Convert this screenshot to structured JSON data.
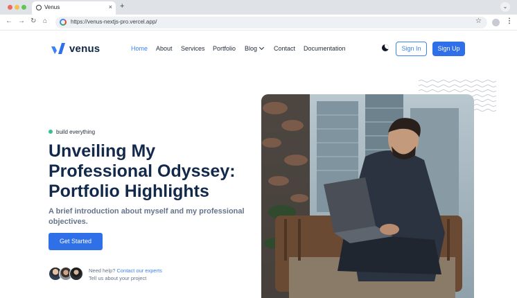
{
  "browser": {
    "tab_title": "Venus",
    "tab_close": "×",
    "new_tab": "+",
    "tabbar_chevron": "⌄",
    "back": "←",
    "forward": "→",
    "reload": "↻",
    "home": "⌂",
    "url": "https://venus-nextjs-pro.vercel.app/",
    "bookmark": "☆",
    "menu": "⋮"
  },
  "header": {
    "logo_text": "venus",
    "nav": [
      {
        "label": "Home",
        "active": true
      },
      {
        "label": "About"
      },
      {
        "label": "Services"
      },
      {
        "label": "Portfolio"
      },
      {
        "label": "Blog"
      },
      {
        "label": "Contact"
      },
      {
        "label": "Documentation"
      }
    ],
    "signin": "Sign In",
    "signup": "Sign Up"
  },
  "hero": {
    "badge": "build everything",
    "title": "Unveiling My Professional Odyssey: Portfolio Highlights",
    "subtitle": "A brief introduction about myself and my professional objectives.",
    "cta": "Get Started",
    "help_prefix": "Need help?",
    "help_link": "Contact our experts",
    "help_line2": "Tell us about your project"
  },
  "colors": {
    "primary": "#2f6fe8",
    "accent_blue": "#3b82f6",
    "heading": "#13294b",
    "muted": "#64748b",
    "badge_dot": "#34c38f"
  },
  "icons": [
    "tab-favicon-icon",
    "close-icon",
    "plus-icon",
    "back-arrow-icon",
    "forward-arrow-icon",
    "reload-icon",
    "home-icon",
    "google-icon",
    "star-icon",
    "profile-icon",
    "kebab-menu-icon",
    "chevron-down-icon",
    "moon-icon"
  ]
}
